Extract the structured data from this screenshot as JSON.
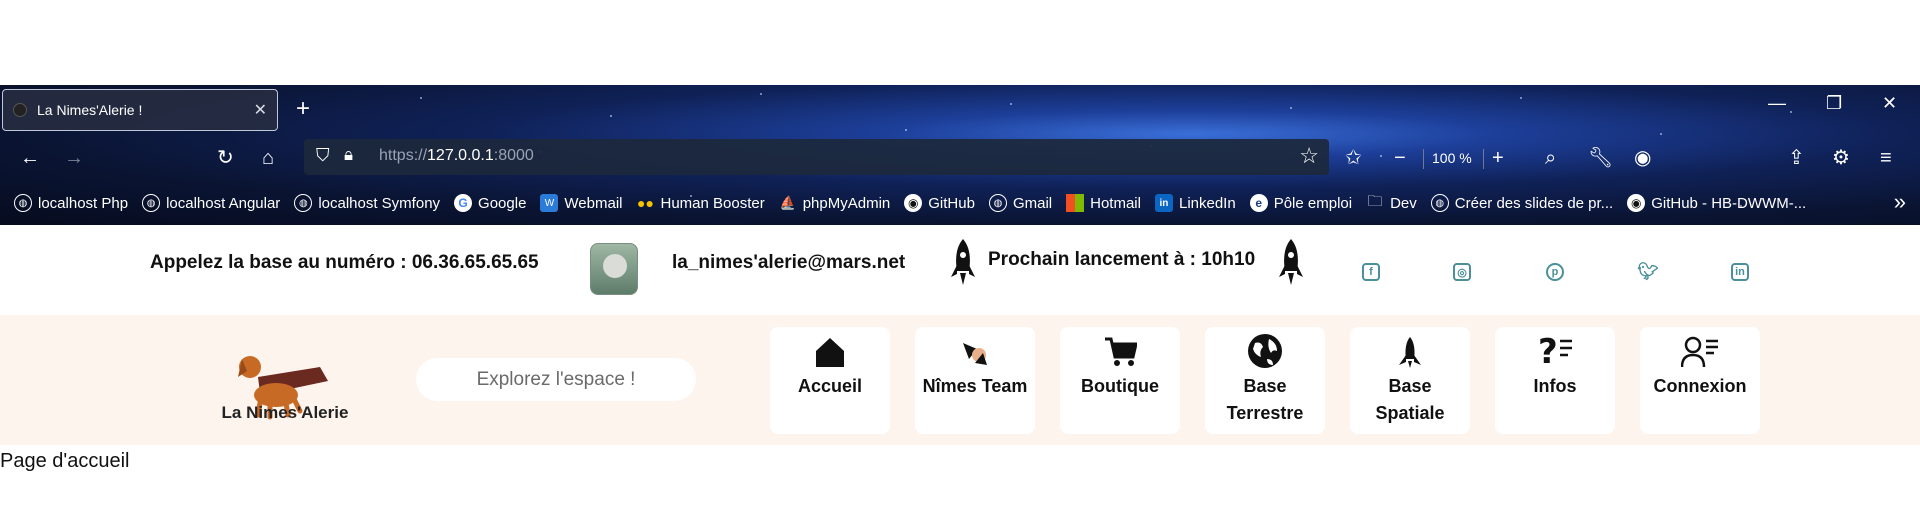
{
  "browser": {
    "tab_title": "La Nimes'Alerie !",
    "tab_close": "✕",
    "new_tab": "+",
    "url_scheme": "https://",
    "url_host": "127.0.0.1",
    "url_port": ":8000",
    "zoom": "100 %",
    "window_controls": [
      "minimize",
      "restore",
      "close"
    ]
  },
  "bookmarks": [
    {
      "label": "localhost Php",
      "icon": "globe-icon"
    },
    {
      "label": "localhost Angular",
      "icon": "globe-icon"
    },
    {
      "label": "localhost Symfony",
      "icon": "globe-icon"
    },
    {
      "label": "Google",
      "icon": "google-icon"
    },
    {
      "label": "Webmail",
      "icon": "webmail-icon"
    },
    {
      "label": "Human Booster",
      "icon": "human-booster-icon"
    },
    {
      "label": "phpMyAdmin",
      "icon": "phpmyadmin-icon"
    },
    {
      "label": "GitHub",
      "icon": "github-icon"
    },
    {
      "label": "Gmail",
      "icon": "globe-icon"
    },
    {
      "label": "Hotmail",
      "icon": "microsoft-icon"
    },
    {
      "label": "LinkedIn",
      "icon": "linkedin-icon"
    },
    {
      "label": "Pôle emploi",
      "icon": "pole-emploi-icon"
    },
    {
      "label": "Dev",
      "icon": "folder-icon"
    },
    {
      "label": "Créer des slides de pr...",
      "icon": "globe-icon"
    },
    {
      "label": "GitHub - HB-DWWM-...",
      "icon": "github-icon"
    }
  ],
  "site": {
    "phone_text": "Appelez la base au numéro : 06.36.65.65.65",
    "email": "la_nimes'alerie@mars.net",
    "launch_text": "Prochain lancement à : 10h10",
    "social": [
      "facebook-icon",
      "instagram-icon",
      "pinterest-icon",
      "twitter-icon",
      "linkedin-icon"
    ],
    "logo_text": "La Nimes'Alerie",
    "search_placeholder": "Explorez l'espace !",
    "nav": [
      {
        "label": "Accueil",
        "icon": "home-icon"
      },
      {
        "label": "Nîmes Team",
        "icon": "team-icon"
      },
      {
        "label": "Boutique",
        "icon": "cart-icon"
      },
      {
        "label": "Base Terrestre",
        "icon": "globe-icon"
      },
      {
        "label": "Base Spatiale",
        "icon": "rocket-icon"
      },
      {
        "label": "Infos",
        "icon": "question-icon"
      },
      {
        "label": "Connexion",
        "icon": "user-icon"
      }
    ],
    "page_label": "Page d'accueil"
  },
  "colors": {
    "accent_teal": "#4a8f99",
    "nav_band": "#fdf4ee",
    "logo_brown": "#b5651d"
  }
}
